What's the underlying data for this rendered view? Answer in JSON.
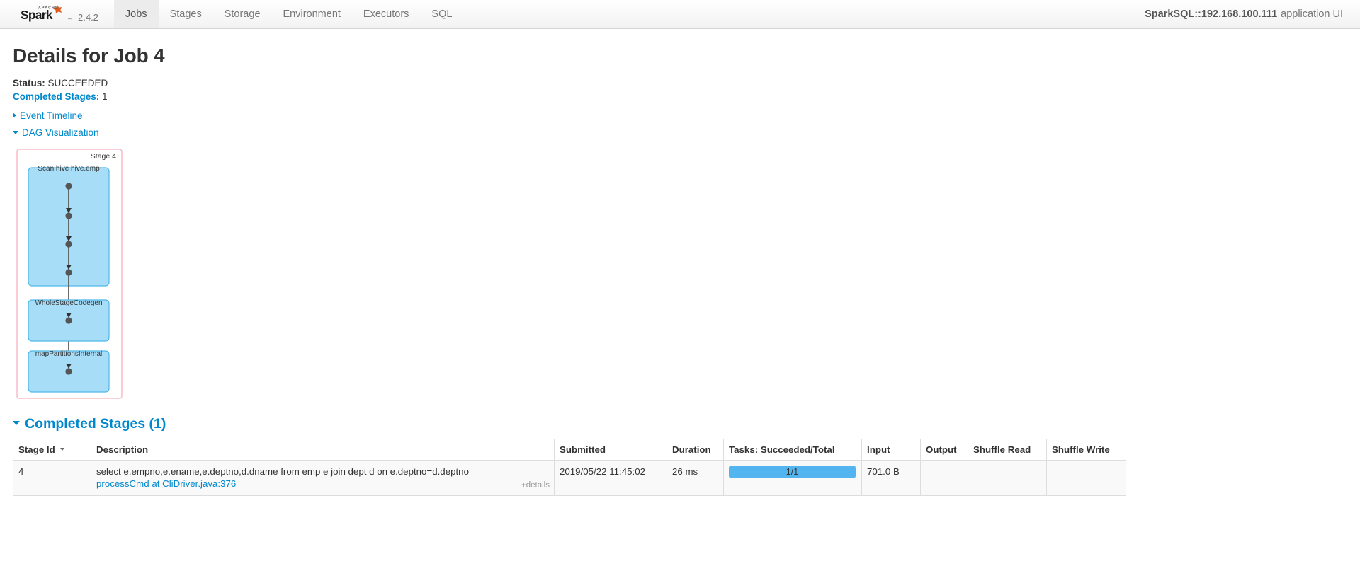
{
  "navbar": {
    "logo_alt": "Apache Spark",
    "version": "2.4.2",
    "tabs": [
      {
        "label": "Jobs",
        "active": true
      },
      {
        "label": "Stages",
        "active": false
      },
      {
        "label": "Storage",
        "active": false
      },
      {
        "label": "Environment",
        "active": false
      },
      {
        "label": "Executors",
        "active": false
      },
      {
        "label": "SQL",
        "active": false
      }
    ],
    "app_name": "SparkSQL::192.168.100.111",
    "app_suffix": "application UI"
  },
  "page": {
    "title": "Details for Job 4",
    "status_label": "Status:",
    "status_value": "SUCCEEDED",
    "completed_stages_label": "Completed Stages:",
    "completed_stages_value": "1",
    "event_timeline_label": "Event Timeline",
    "dag_visualization_label": "DAG Visualization"
  },
  "dag": {
    "stage_label": "Stage 4",
    "border_color": "#f7b2c0",
    "node_fill": "#a7ddf7",
    "node_stroke": "#4fb8e8",
    "dot_color": "#555555",
    "nodes": [
      {
        "label": "Scan hive hive.emp",
        "dots": 4
      },
      {
        "label": "WholeStageCodegen",
        "dots": 1
      },
      {
        "label": "mapPartitionsInternal",
        "dots": 1
      }
    ]
  },
  "completed_stages": {
    "heading": "Completed Stages (1)",
    "columns": [
      "Stage Id",
      "Description",
      "Submitted",
      "Duration",
      "Tasks: Succeeded/Total",
      "Input",
      "Output",
      "Shuffle Read",
      "Shuffle Write"
    ],
    "sorted_column": "Stage Id",
    "rows": [
      {
        "stage_id": "4",
        "description": "select e.empno,e.ename,e.deptno,d.dname from emp e join dept d on e.deptno=d.deptno",
        "description_link": "processCmd at CliDriver.java:376",
        "details_label": "+details",
        "submitted": "2019/05/22 11:45:02",
        "duration": "26 ms",
        "tasks_text": "1/1",
        "tasks_percent": 100,
        "input": "701.0 B",
        "output": "",
        "shuffle_read": "",
        "shuffle_write": ""
      }
    ]
  },
  "colors": {
    "link": "#0088cc",
    "progress": "#53b5f0",
    "nav_active_bg": "#ececec"
  }
}
